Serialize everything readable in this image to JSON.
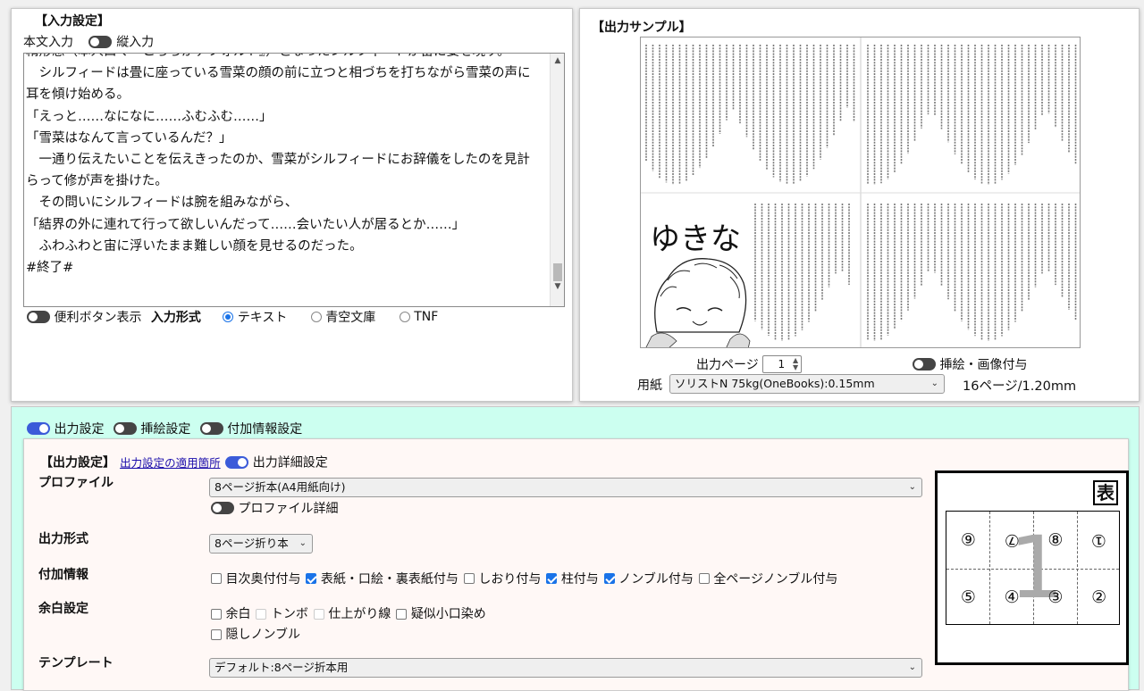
{
  "input": {
    "title": "【入力設定】",
    "body_label": "本文入力",
    "vertical_label": "縦入力",
    "lines": [
      "精形態（本人曰く『こちらがデフォルト』）となったシルフィードが宙に姿を現す。",
      "　シルフィードは畳に座っている雪菜の顔の前に立つと相づちを打ちながら雪菜の声に",
      "耳を傾け始める。",
      "「えっと……なになに……ふむふむ……」",
      "「雪菜はなんて言っているんだ？」",
      "　一通り伝えたいことを伝えきったのか、雪菜がシルフィードにお辞儀をしたのを見計",
      "らって修が声を掛けた。",
      "　その問いにシルフィードは腕を組みながら、",
      "「結界の外に連れて行って欲しいんだって……会いたい人が居るとか……」",
      "　ふわふわと宙に浮いたまま難しい顔を見せるのだった。",
      "#終了#"
    ],
    "helper_buttons_label": "便利ボタン表示",
    "format_label": "入力形式",
    "formats": [
      "テキスト",
      "青空文庫",
      "TNF"
    ],
    "selected_format": "テキスト"
  },
  "sample": {
    "title": "【出力サンプル】",
    "illustration_text": "ゆきな",
    "page_label": "出力ページ",
    "page_value": "1",
    "illustration_toggle_label": "挿絵・画像付与",
    "paper_label": "用紙",
    "paper_value": "ソリストN 75kg(OneBooks):0.15mm",
    "thickness": "16ページ/1.20mm"
  },
  "lower": {
    "tabs": [
      "出力設定",
      "挿絵設定",
      "付加情報設定"
    ],
    "output_title": "【出力設定】",
    "apply_link": "出力設定の適用箇所",
    "detail_label": "出力詳細設定",
    "profile_label": "プロファイル",
    "profile_value": "8ページ折本(A4用紙向け)",
    "profile_detail_label": "プロファイル詳細",
    "format_label": "出力形式",
    "format_value": "8ページ折り本",
    "extra_label": "付加情報",
    "extras": [
      {
        "label": "目次奥付付与",
        "checked": false
      },
      {
        "label": "表紙・口絵・裏表紙付与",
        "checked": true
      },
      {
        "label": "しおり付与",
        "checked": false
      },
      {
        "label": "柱付与",
        "checked": true
      },
      {
        "label": "ノンブル付与",
        "checked": true
      },
      {
        "label": "全ページノンブル付与",
        "checked": false
      }
    ],
    "margin_label": "余白設定",
    "margins": [
      {
        "label": "余白",
        "checked": false,
        "enabled": true
      },
      {
        "label": "トンボ",
        "checked": false,
        "enabled": false
      },
      {
        "label": "仕上がり線",
        "checked": false,
        "enabled": false
      },
      {
        "label": "疑似小口染め",
        "checked": false,
        "enabled": true
      },
      {
        "label": "隠しノンブル",
        "checked": false,
        "enabled": true
      }
    ],
    "template_label": "テンプレート",
    "template_value": "デフォルト:8ページ折本用"
  },
  "diagram": {
    "side": "表",
    "big_number": "1",
    "top_row": [
      "⑨",
      "⑦",
      "⑧",
      "①"
    ],
    "top_rotated": [
      false,
      true,
      false,
      true
    ],
    "bottom_row": [
      "⑤",
      "④",
      "③",
      "②"
    ]
  },
  "colors": {
    "accent": "#3b5bd9",
    "lower_bg": "#ccfff0",
    "card_bg": "#fff8f6"
  }
}
